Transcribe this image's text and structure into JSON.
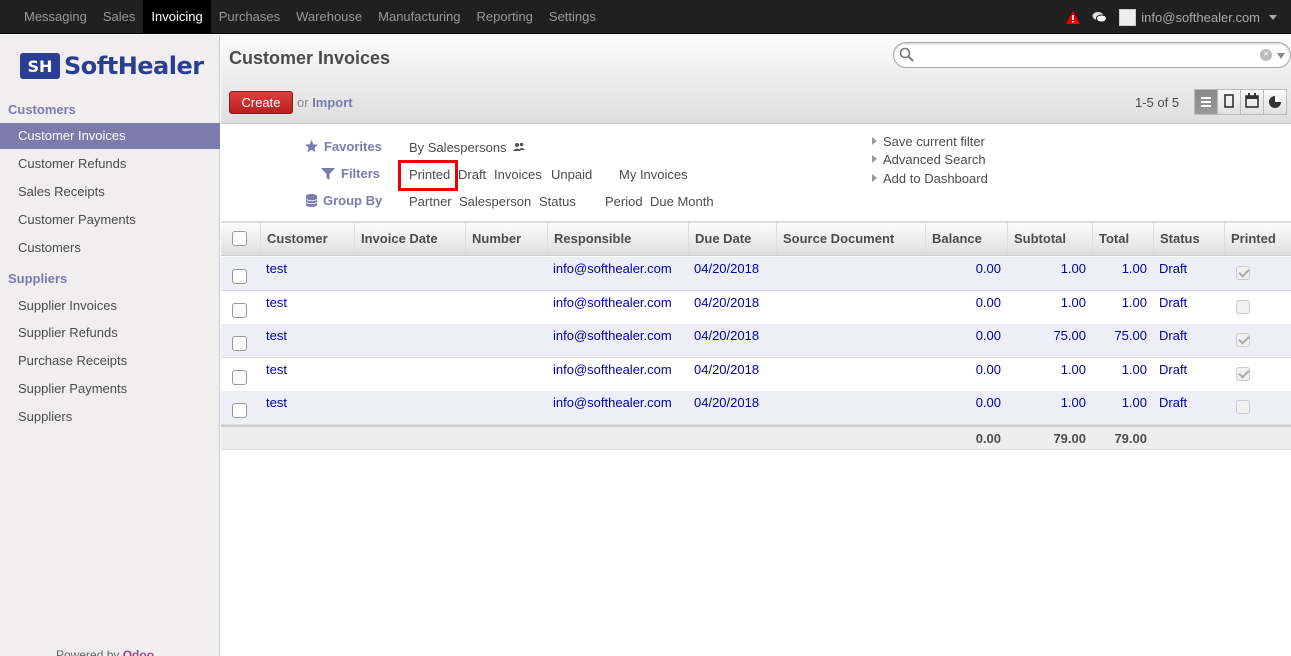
{
  "topbar": {
    "menu": [
      "Messaging",
      "Sales",
      "Invoicing",
      "Purchases",
      "Warehouse",
      "Manufacturing",
      "Reporting",
      "Settings"
    ],
    "active_index": 2,
    "user_email": "info@softhealer.com"
  },
  "sidebar": {
    "logo_text": "SoftHealer",
    "logo_mark": "SH",
    "sections": [
      {
        "title": "Customers",
        "items": [
          "Customer Invoices",
          "Customer Refunds",
          "Sales Receipts",
          "Customer Payments",
          "Customers"
        ]
      },
      {
        "title": "Suppliers",
        "items": [
          "Supplier Invoices",
          "Supplier Refunds",
          "Purchase Receipts",
          "Supplier Payments",
          "Suppliers"
        ]
      }
    ],
    "active_item": "Customer Invoices",
    "powered_prefix": "Powered by",
    "powered_brand": "Odoo"
  },
  "header": {
    "title": "Customer Invoices",
    "search_value": "",
    "create_label": "Create",
    "or_text": "or",
    "import_label": "Import",
    "pager": "1-5 of 5"
  },
  "drawer": {
    "favorites_label": "Favorites",
    "filters_label": "Filters",
    "groupby_label": "Group By",
    "favorites": [
      "By Salespersons"
    ],
    "filters": [
      "Printed",
      "Draft",
      "Invoices",
      "Unpaid",
      "My Invoices"
    ],
    "groupby": [
      "Partner",
      "Salesperson",
      "Status",
      "Period",
      "Due Month"
    ],
    "links": [
      "Save current filter",
      "Advanced Search",
      "Add to Dashboard"
    ]
  },
  "table": {
    "columns": [
      "Customer",
      "Invoice Date",
      "Number",
      "Responsible",
      "Due Date",
      "Source Document",
      "Balance",
      "Subtotal",
      "Total",
      "Status",
      "Printed"
    ],
    "rows": [
      {
        "customer": "test",
        "invoice_date": "",
        "number": "",
        "responsible": "info@softhealer.com",
        "due_date": "04/20/2018",
        "source": "",
        "balance": "0.00",
        "subtotal": "1.00",
        "total": "1.00",
        "status": "Draft",
        "printed": true
      },
      {
        "customer": "test",
        "invoice_date": "",
        "number": "",
        "responsible": "info@softhealer.com",
        "due_date": "04/20/2018",
        "source": "",
        "balance": "0.00",
        "subtotal": "1.00",
        "total": "1.00",
        "status": "Draft",
        "printed": false
      },
      {
        "customer": "test",
        "invoice_date": "",
        "number": "",
        "responsible": "info@softhealer.com",
        "due_date": "04/20/2018",
        "source": "",
        "balance": "0.00",
        "subtotal": "75.00",
        "total": "75.00",
        "status": "Draft",
        "printed": true
      },
      {
        "customer": "test",
        "invoice_date": "",
        "number": "",
        "responsible": "info@softhealer.com",
        "due_date": "04/20/2018",
        "source": "",
        "balance": "0.00",
        "subtotal": "1.00",
        "total": "1.00",
        "status": "Draft",
        "printed": true
      },
      {
        "customer": "test",
        "invoice_date": "",
        "number": "",
        "responsible": "info@softhealer.com",
        "due_date": "04/20/2018",
        "source": "",
        "balance": "0.00",
        "subtotal": "1.00",
        "total": "1.00",
        "status": "Draft",
        "printed": false
      }
    ],
    "totals": {
      "balance": "0.00",
      "subtotal": "79.00",
      "total": "79.00"
    }
  },
  "icons": {
    "warning": "warning-triangle-icon",
    "chat": "chat-bubbles-icon",
    "search": "magnifier-icon",
    "favorites": "star-icon",
    "filters": "funnel-icon",
    "groupby": "database-stack-icon",
    "salespersons": "users-icon",
    "views": [
      "list-view-icon",
      "form-view-icon",
      "calendar-view-icon",
      "graph-view-icon"
    ]
  },
  "colors": {
    "accent": "#7c7bad",
    "create": "#c82828",
    "link": "#0000aa",
    "highlight": "#ee0000"
  }
}
